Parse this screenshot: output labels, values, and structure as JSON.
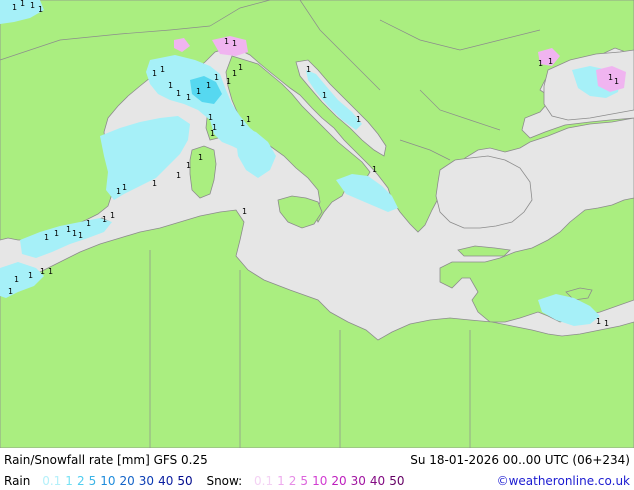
{
  "map": {
    "colors": {
      "sea": "#e6e6e6",
      "land": "#aaee80",
      "border": "#9a9a9a",
      "rain_light": "#a6f0f8",
      "rain_mid": "#56d8f0",
      "snow": "#f0b4f0"
    },
    "rain_glyph": "1"
  },
  "footer": {
    "title": "Rain/Snowfall rate [mm] GFS 0.25",
    "valid": "Su 18-01-2026 00..00 UTC (06+234)",
    "rain_label": "Rain",
    "snow_label": "Snow:",
    "rain_scale": [
      {
        "v": "0.1",
        "color": "#b4f0fa"
      },
      {
        "v": "1",
        "color": "#78e2f4"
      },
      {
        "v": "2",
        "color": "#50cdf0"
      },
      {
        "v": "5",
        "color": "#3cb4e6"
      },
      {
        "v": "10",
        "color": "#1e8cdc"
      },
      {
        "v": "20",
        "color": "#1464c8"
      },
      {
        "v": "30",
        "color": "#0a3cb4"
      },
      {
        "v": "40",
        "color": "#0a1ea0"
      },
      {
        "v": "50",
        "color": "#000a8c"
      }
    ],
    "snow_scale": [
      {
        "v": "0.1",
        "color": "#f4d2f4"
      },
      {
        "v": "1",
        "color": "#eeaaee"
      },
      {
        "v": "2",
        "color": "#e68ce6"
      },
      {
        "v": "5",
        "color": "#dc64dc"
      },
      {
        "v": "10",
        "color": "#d23cd2"
      },
      {
        "v": "20",
        "color": "#be1ebe"
      },
      {
        "v": "30",
        "color": "#a014a0"
      },
      {
        "v": "40",
        "color": "#820a82"
      },
      {
        "v": "50",
        "color": "#640064"
      }
    ],
    "credit": "©weatheronline.co.uk"
  }
}
